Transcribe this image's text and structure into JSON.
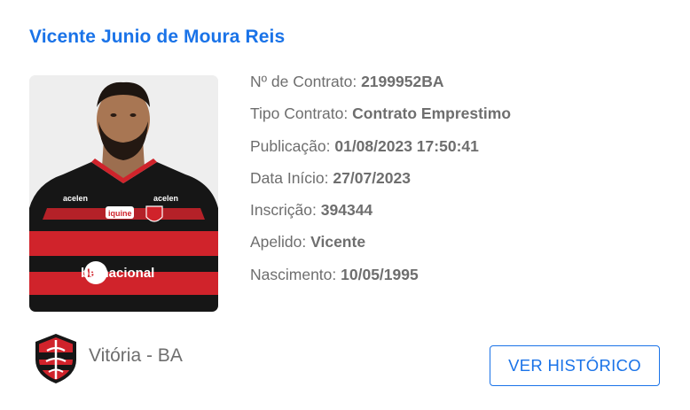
{
  "player": {
    "name": "Vicente Junio de Moura Reis",
    "photo_icon": "player-photo"
  },
  "details": [
    {
      "label": "Nº de Contrato:",
      "value": "2199952BA"
    },
    {
      "label": "Tipo Contrato:",
      "value": "Contrato Emprestimo"
    },
    {
      "label": "Publicação:",
      "value": "01/08/2023 17:50:41"
    },
    {
      "label": "Data Início:",
      "value": "27/07/2023"
    },
    {
      "label": "Inscrição:",
      "value": "394344"
    },
    {
      "label": "Apelido:",
      "value": "Vicente"
    },
    {
      "label": "Nascimento:",
      "value": "10/05/1995"
    }
  ],
  "club": {
    "name": "Vitória - BA",
    "crest_icon": "club-crest-icon"
  },
  "jersey_text": {
    "sponsor_main": "betnacional",
    "sponsor_left": "acelen",
    "sponsor_right": "acelen",
    "sponsor_center": "iquine"
  },
  "actions": {
    "history_label": "VER HISTÓRICO"
  },
  "colors": {
    "name_blue": "#1a73e8",
    "text_gray": "#6e6e6e",
    "jersey_red": "#d0232b",
    "jersey_black": "#161616"
  }
}
